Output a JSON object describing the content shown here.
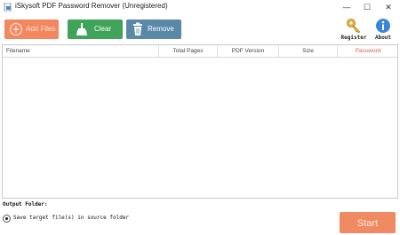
{
  "window": {
    "title": "iSkysoft PDF Password Remover (Unregistered)",
    "minimize_glyph": "—",
    "maximize_glyph": "☐",
    "close_glyph": "✕"
  },
  "toolbar": {
    "add_label": "Add Files",
    "clear_label": "Clear",
    "remove_label": "Remove",
    "register_label": "Register",
    "about_label": "About"
  },
  "icons": {
    "add": "plus-circle-icon",
    "clear": "broom-icon",
    "remove": "trash-icon",
    "register": "key-icon",
    "about": "info-icon"
  },
  "colors": {
    "add_button": "#f28760",
    "clear_button": "#3fa45a",
    "remove_button": "#5a88a8",
    "start_button": "#f08a62",
    "password_header": "#e05a5a"
  },
  "table": {
    "columns": [
      "Filename",
      "Total Pages",
      "PDF Version",
      "Size",
      "Password"
    ],
    "rows": []
  },
  "output": {
    "heading": "Output Folder:",
    "option_source": "Save target file(s) in source folder",
    "option_source_selected": true
  },
  "actions": {
    "start_label": "Start"
  }
}
